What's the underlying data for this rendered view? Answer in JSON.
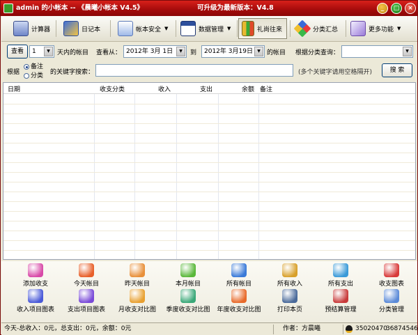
{
  "window": {
    "title": "admin 的小帐本 -- 《晨曦小帐本 V4.5》",
    "update_notice": "可升级为最新版本：V4.8",
    "min": "_",
    "max": "□",
    "close": "×"
  },
  "toolbar": {
    "calculator": "计算器",
    "diary": "日记本",
    "account_security": "帐本安全",
    "data_management": "数据管理",
    "gifts": "礼尚往来",
    "category_summary": "分类汇总",
    "more": "更多功能",
    "dropdown_arrow": "▼"
  },
  "query": {
    "view_button": "查看",
    "days_value": "1",
    "days_label": "天内的帐目",
    "from_label": "查看从：",
    "from_date": "2012年 3月 1日",
    "to_label": "到",
    "to_date": "2012年 3月19日",
    "to_suffix": "的帐目",
    "category_label": "根据分类查询：",
    "category_value": ""
  },
  "keyword": {
    "by_label": "根据",
    "option_note": "备注",
    "option_category": "分类",
    "search_label": "的关键字搜索：",
    "search_value": "",
    "hint": "(多个关键字请用空格隔开)",
    "search_button": "搜 索"
  },
  "table": {
    "columns": [
      "日期",
      "收支分类",
      "收入",
      "支出",
      "余额",
      "备注"
    ]
  },
  "bottom_buttons": [
    {
      "label": "添加收支",
      "icon": "add-entry-icon"
    },
    {
      "label": "今天帐目",
      "icon": "today-icon"
    },
    {
      "label": "昨天帐目",
      "icon": "yesterday-icon"
    },
    {
      "label": "本月帐目",
      "icon": "month-icon"
    },
    {
      "label": "所有帐目",
      "icon": "all-accounts-icon"
    },
    {
      "label": "所有收入",
      "icon": "all-income-icon"
    },
    {
      "label": "所有支出",
      "icon": "all-expense-icon"
    },
    {
      "label": "收支图表",
      "icon": "pie-chart-icon"
    },
    {
      "label": "收入项目图表",
      "icon": "income-chart-icon"
    },
    {
      "label": "支出项目图表",
      "icon": "expense-chart-icon"
    },
    {
      "label": "月收支对比图",
      "icon": "monthly-compare-icon"
    },
    {
      "label": "季度收支对比图",
      "icon": "quarterly-compare-icon"
    },
    {
      "label": "年度收支对比图",
      "icon": "yearly-compare-icon"
    },
    {
      "label": "打印本页",
      "icon": "print-icon"
    },
    {
      "label": "预结算管理",
      "icon": "settlement-icon"
    },
    {
      "label": "分类管理",
      "icon": "category-manage-icon"
    }
  ],
  "status": {
    "summary": "今天-总收入：0元，总支出：0元，余额：0元",
    "author": "作者：方晨曦",
    "qq1": "35020470",
    "qq2": "36874546"
  },
  "colors": {
    "title_bar": "#b0130f",
    "window_bg": "#ece9d8",
    "grid_line": "#e2e6ef"
  }
}
